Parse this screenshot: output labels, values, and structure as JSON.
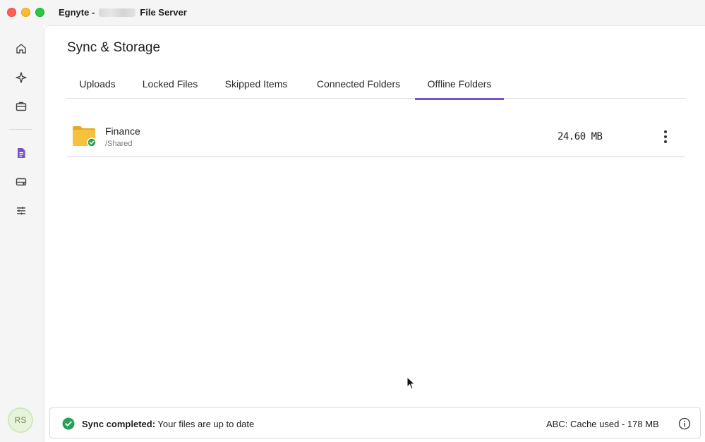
{
  "window": {
    "title_prefix": "Egnyte -",
    "title_suffix": "File Server"
  },
  "sidebar": {
    "items": [
      {
        "name": "home-icon"
      },
      {
        "name": "sparkle-icon"
      },
      {
        "name": "briefcase-icon"
      },
      {
        "name": "document-icon",
        "active": true
      },
      {
        "name": "drive-icon"
      },
      {
        "name": "sliders-icon"
      }
    ],
    "avatar_initials": "RS"
  },
  "page": {
    "title": "Sync & Storage"
  },
  "tabs": [
    {
      "label": "Uploads"
    },
    {
      "label": "Locked Files"
    },
    {
      "label": "Skipped Items"
    },
    {
      "label": "Connected Folders"
    },
    {
      "label": "Offline Folders",
      "active": true
    }
  ],
  "folders": [
    {
      "name": "Finance",
      "path": "/Shared",
      "size": "24.60 MB",
      "status": "synced"
    }
  ],
  "status": {
    "bold": "Sync completed:",
    "message": "Your files are up to date",
    "cache": "ABC: Cache used - 178 MB"
  },
  "colors": {
    "accent": "#7a52c7",
    "success": "#27a15a",
    "folder": "#f6c13c"
  }
}
